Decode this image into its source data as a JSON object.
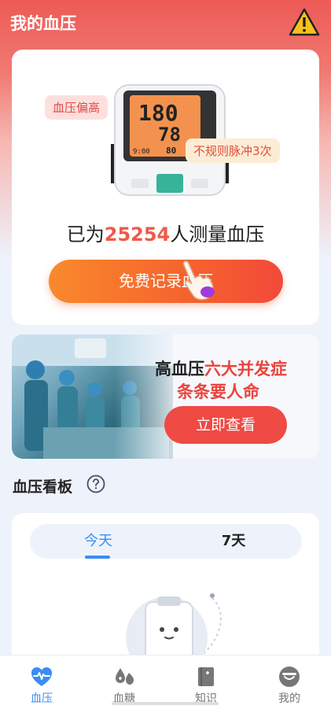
{
  "header": {
    "title": "我的血压"
  },
  "measure_card": {
    "tag_high": "血压偏高",
    "tag_pulse": "不规则脉冲3次",
    "display": {
      "systolic": "180",
      "diastolic": "78",
      "pulse": "80",
      "time": "9:00"
    },
    "count_prefix": "已为",
    "count_value": "25254",
    "count_suffix": "人测量血压",
    "record_button": "免费记录血压"
  },
  "banner": {
    "line1_a": "高血压",
    "line1_b": "六大并发症",
    "line2": "条条要人命",
    "button": "立即查看"
  },
  "board": {
    "title": "血压看板",
    "tabs": [
      "今天",
      "7天"
    ],
    "active_tab": 0
  },
  "tabbar": {
    "items": [
      {
        "label": "血压",
        "icon": "heart-pulse-icon"
      },
      {
        "label": "血糖",
        "icon": "drops-icon"
      },
      {
        "label": "知识",
        "icon": "book-icon"
      },
      {
        "label": "我的",
        "icon": "profile-icon"
      }
    ],
    "active": 0
  },
  "colors": {
    "accent": "#3b8df3",
    "red": "#ef4a44",
    "orange": "#f88a2c"
  }
}
